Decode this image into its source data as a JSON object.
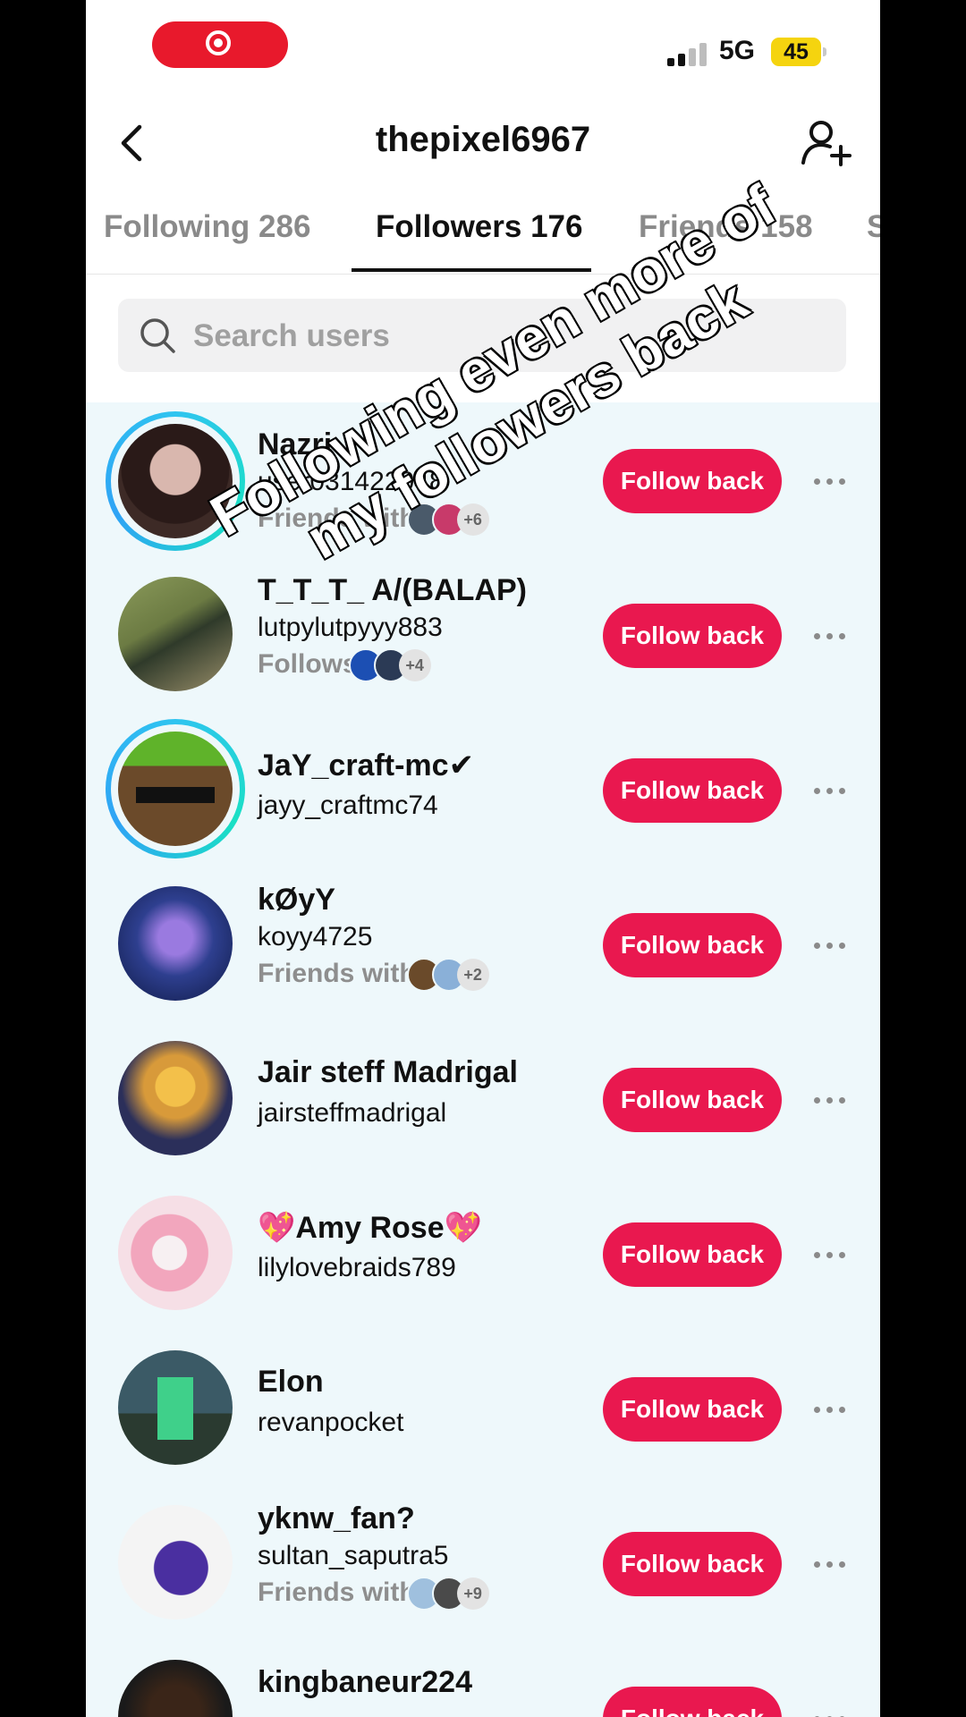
{
  "status_bar": {
    "network": "5G",
    "battery": "45"
  },
  "header": {
    "title": "thepixel6967"
  },
  "tabs": [
    {
      "label": "Following 286"
    },
    {
      "label": "Followers 176"
    },
    {
      "label": "Friends 158"
    },
    {
      "label": "S"
    }
  ],
  "search": {
    "placeholder": "Search users"
  },
  "overlay_caption": "Following even more of my followers back",
  "followers": [
    {
      "name": "Nazri",
      "handle": "user031422048",
      "mutual": "Friends with",
      "extra": "+6",
      "button": "Follow back"
    },
    {
      "name": "T_T_T_ A/(BALAP)",
      "handle": "lutpylutpyyy883",
      "mutual": "Follows",
      "extra": "+4",
      "button": "Follow back"
    },
    {
      "name": "JaY_craft-mc✔",
      "handle": "jayy_craftmc74",
      "mutual": "",
      "extra": "",
      "button": "Follow back"
    },
    {
      "name": "kØyY",
      "handle": "koyy4725",
      "mutual": "Friends with",
      "extra": "+2",
      "button": "Follow back"
    },
    {
      "name": "Jair steff Madrigal",
      "handle": "jairsteffmadrigal",
      "mutual": "",
      "extra": "",
      "button": "Follow back"
    },
    {
      "name": "💖Amy Rose💖",
      "handle": "lilylovebraids789",
      "mutual": "",
      "extra": "",
      "button": "Follow back"
    },
    {
      "name": "Elon",
      "handle": "revanpocket",
      "mutual": "",
      "extra": "",
      "button": "Follow back"
    },
    {
      "name": "yknw_fan?",
      "handle": "sultan_saputra5",
      "mutual": "Friends with",
      "extra": "+9",
      "button": "Follow back"
    },
    {
      "name": "kingbaneur224",
      "handle": "",
      "mutual": "",
      "extra": "",
      "button": "Follow back"
    }
  ],
  "colors": {
    "accent": "#e9184f",
    "list_bg": "#eef8fb",
    "story_ring": "#2fc4f0"
  }
}
